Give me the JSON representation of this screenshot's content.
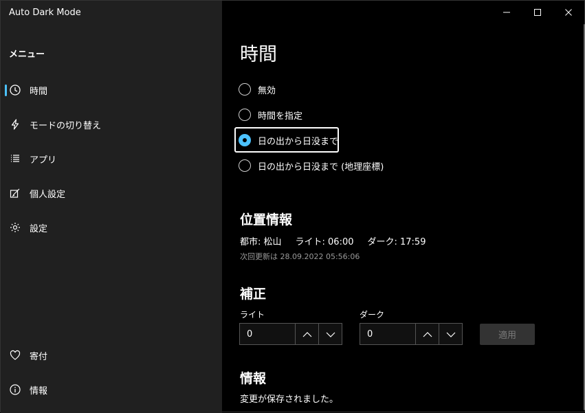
{
  "window": {
    "title": "Auto Dark Mode",
    "controls": {
      "minimize": "minimize-icon",
      "maximize": "maximize-icon",
      "close": "close-icon"
    }
  },
  "sidebar": {
    "menu_label": "メニュー",
    "items": [
      {
        "label": "時間",
        "icon": "clock-icon",
        "active": true
      },
      {
        "label": "モードの切り替え",
        "icon": "lightning-icon",
        "active": false
      },
      {
        "label": "アプリ",
        "icon": "list-icon",
        "active": false
      },
      {
        "label": "個人設定",
        "icon": "edit-icon",
        "active": false
      },
      {
        "label": "設定",
        "icon": "gear-icon",
        "active": false
      }
    ],
    "bottom_items": [
      {
        "label": "寄付",
        "icon": "heart-icon"
      },
      {
        "label": "情報",
        "icon": "info-icon"
      }
    ]
  },
  "main": {
    "title": "時間",
    "radio_options": [
      {
        "label": "無効",
        "checked": false
      },
      {
        "label": "時間を指定",
        "checked": false
      },
      {
        "label": "日の出から日没まで",
        "checked": true
      },
      {
        "label": "日の出から日没まで (地理座標)",
        "checked": false
      }
    ],
    "location": {
      "title": "位置情報",
      "city": "都市: 松山",
      "light": "ライト: 06:00",
      "dark": "ダーク: 17:59",
      "next_update": "次回更新は 28.09.2022 05:56:06"
    },
    "offset": {
      "title": "補正",
      "light_label": "ライト",
      "light_value": "0",
      "dark_label": "ダーク",
      "dark_value": "0",
      "apply_label": "適用"
    },
    "info": {
      "title": "情報",
      "status": "変更が保存されました。"
    }
  },
  "colors": {
    "accent": "#4cc2ff",
    "sidebar_bg": "#202020",
    "content_bg": "#000000"
  }
}
